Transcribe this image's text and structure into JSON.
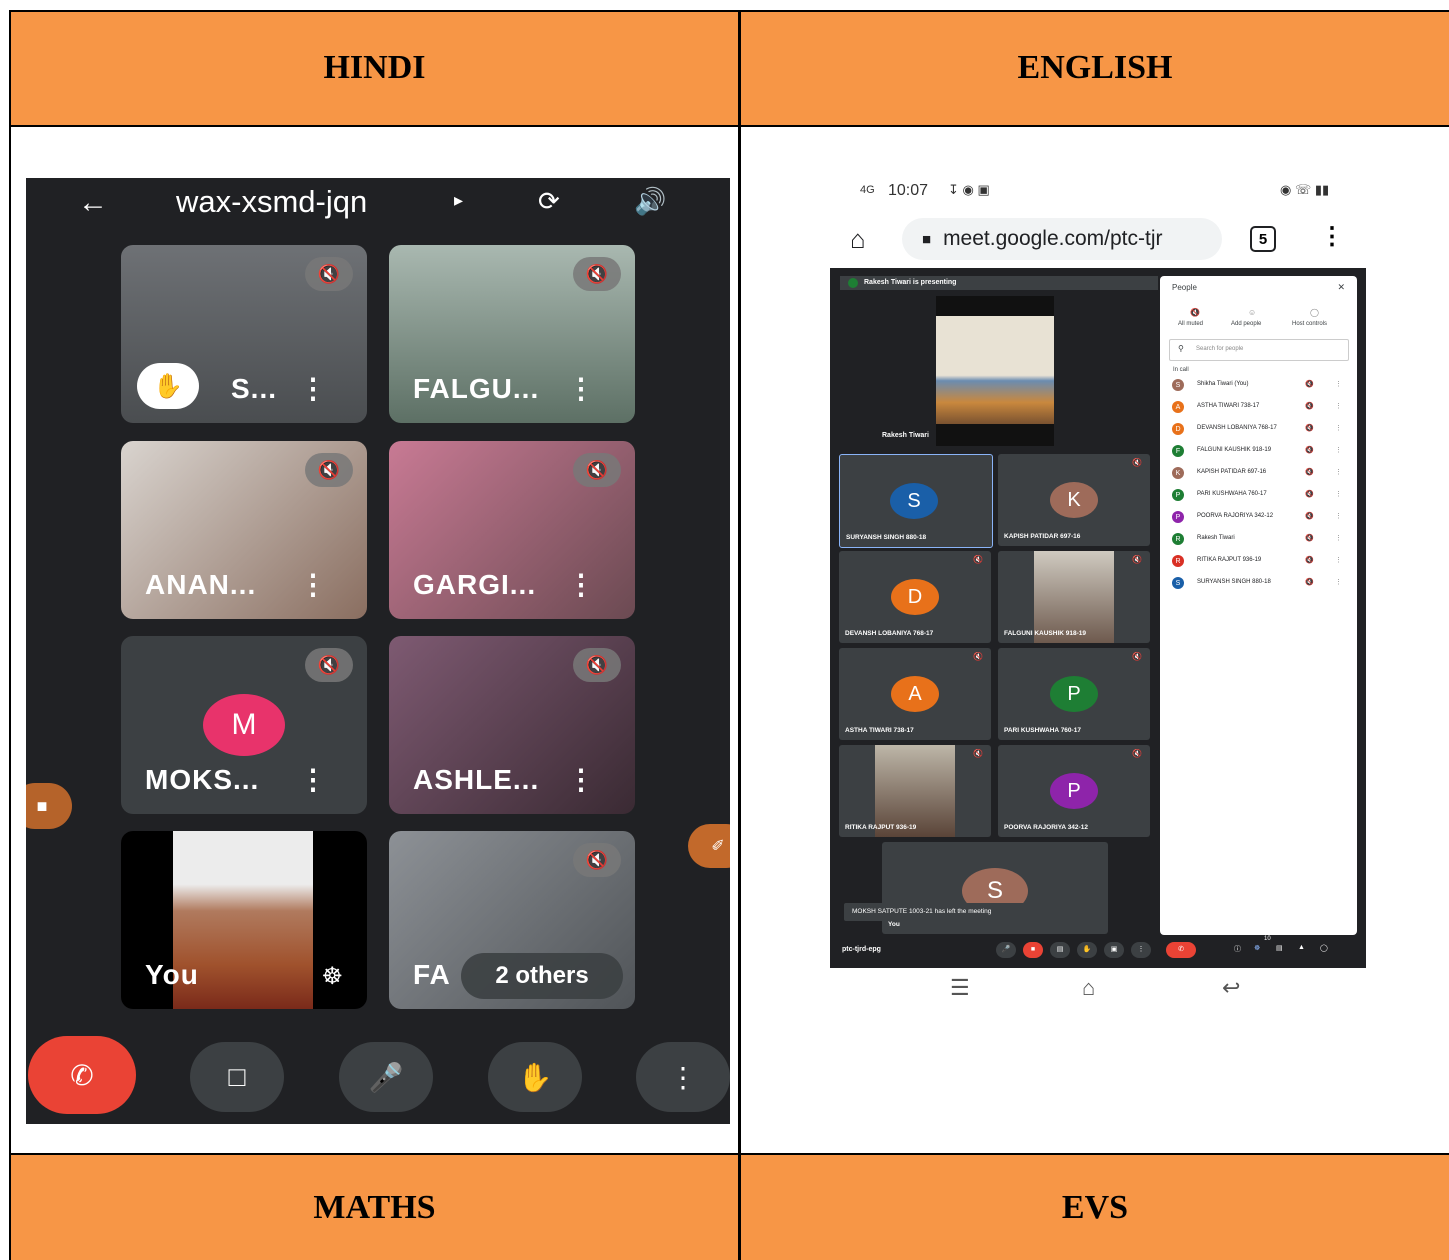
{
  "headers": {
    "top_left": "HINDI",
    "top_right": "ENGLISH",
    "bottom_left": "MATHS",
    "bottom_right": "EVS"
  },
  "left_call": {
    "meeting_code": "wax-xsmd-jqn",
    "tiles": [
      {
        "name": "S...",
        "hand_raised": true
      },
      {
        "name": "FALGU..."
      },
      {
        "name": "ANAN..."
      },
      {
        "name": "GARGI..."
      },
      {
        "name": "MOKS...",
        "avatar_letter": "M",
        "avatar_color": "#e8336b"
      },
      {
        "name": "ASHLE..."
      },
      {
        "name": "You"
      },
      {
        "name": "FA",
        "others_label": "2 others"
      }
    ]
  },
  "right_call": {
    "status_time": "10:07",
    "url": "meet.google.com/ptc-tjr",
    "tab_count": "5",
    "presenting_banner": "Rakesh Tiwari is presenting",
    "presenter_label": "Rakesh Tiwari",
    "tiles": [
      {
        "label": "SURYANSH SINGH 880-18",
        "letter": "S",
        "color": "#1a5fa8"
      },
      {
        "label": "KAPISH PATIDAR 697-16",
        "letter": "K",
        "color": "#9e6b5a"
      },
      {
        "label": "DEVANSH LOBANIYA 768-17",
        "letter": "D",
        "color": "#e8711a"
      },
      {
        "label": "FALGUNI KAUSHIK 918-19"
      },
      {
        "label": "ASTHA TIWARI 738-17",
        "letter": "A",
        "color": "#e8711a"
      },
      {
        "label": "PARI KUSHWAHA 760-17",
        "letter": "P",
        "color": "#1e7e34"
      },
      {
        "label": "RITIKA RAJPUT 936-19"
      },
      {
        "label": "POORVA RAJORIYA 342-12",
        "letter": "P",
        "color": "#8e24aa"
      }
    ],
    "self_letter": "S",
    "self_label": "You",
    "toast": "MOKSH SATPUTE 1003-21 has left the meeting",
    "meeting_code": "ptc-tjrd-epg",
    "participant_count": "10",
    "people_panel": {
      "title": "People",
      "actions": [
        "All muted",
        "Add people",
        "Host controls"
      ],
      "search_placeholder": "Search for people",
      "section": "In call",
      "people": [
        {
          "letter": "S",
          "name": "Shikha Tiwari (You)",
          "color": "#9e6b5a"
        },
        {
          "letter": "A",
          "name": "ASTHA TIWARI 738-17",
          "color": "#e8711a"
        },
        {
          "letter": "D",
          "name": "DEVANSH LOBANIYA 768-17",
          "color": "#e8711a"
        },
        {
          "letter": "F",
          "name": "FALGUNI KAUSHIK 918-19",
          "color": "#1e7e34"
        },
        {
          "letter": "K",
          "name": "KAPISH PATIDAR 697-16",
          "color": "#9e6b5a"
        },
        {
          "letter": "P",
          "name": "PARI KUSHWAHA 760-17",
          "color": "#1e7e34"
        },
        {
          "letter": "P",
          "name": "POORVA RAJORIYA 342-12",
          "color": "#8e24aa"
        },
        {
          "letter": "R",
          "name": "Rakesh Tiwari",
          "color": "#1e7e34"
        },
        {
          "letter": "R",
          "name": "RITIKA RAJPUT 936-19",
          "color": "#d93025"
        },
        {
          "letter": "S",
          "name": "SURYANSH SINGH 880-18",
          "color": "#1a5fa8"
        }
      ]
    }
  }
}
